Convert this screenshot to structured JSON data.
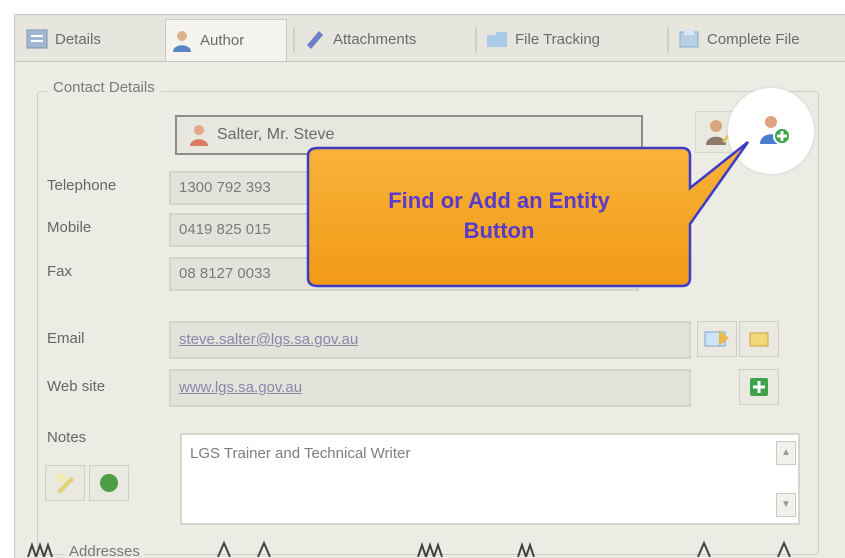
{
  "tabs": [
    {
      "label": "Details",
      "icon": "details-icon",
      "active": false
    },
    {
      "label": "Author",
      "icon": "author-icon",
      "active": true
    },
    {
      "label": "Attachments",
      "icon": "attachments-icon",
      "active": false
    },
    {
      "label": "File Tracking",
      "icon": "file-tracking-icon",
      "active": false
    },
    {
      "label": "Complete File",
      "icon": "complete-file-icon",
      "active": false
    }
  ],
  "contact": {
    "group_label": "Contact Details",
    "entity_name": "Salter, Mr. Steve",
    "telephone_label": "Telephone",
    "telephone": "1300 792 393",
    "mobile_label": "Mobile",
    "mobile": "0419 825 015",
    "fax_label": "Fax",
    "fax": "08 8127 0033",
    "email_label": "Email",
    "email": "steve.salter@lgs.sa.gov.au",
    "website_label": "Web site",
    "website": "www.lgs.sa.gov.au",
    "notes_label": "Notes",
    "notes": "LGS Trainer and Technical Writer"
  },
  "addresses_label": "Addresses",
  "callout": {
    "line1": "Find or Add an Entity",
    "line2": "Button"
  },
  "colors": {
    "callout_fill": "#f5a623",
    "callout_border": "#3c3cc8",
    "callout_text": "#5a3acb"
  }
}
